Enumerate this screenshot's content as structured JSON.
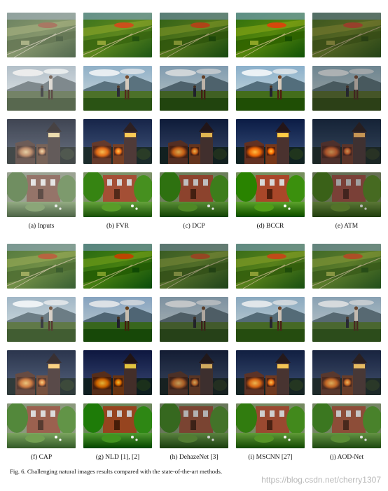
{
  "top_labels": [
    "(a) Inputs",
    "(b) FVR",
    "(c) DCP",
    "(d) BCCR",
    "(e) ATM"
  ],
  "bottom_labels": [
    "(f) CAP",
    "(g) NLD [1], [2]",
    "(h) DehazeNet [3]",
    "(i) MSCNN [27]",
    "(j) AOD-Net"
  ],
  "caption": "Fig. 6.  Challenging natural images results compared with the state-of-the-art methods.",
  "watermark": "https://blog.csdn.net/cherry1307",
  "scenes": [
    "aerial-fields",
    "hiker-mountain",
    "castle-night",
    "garden-house"
  ],
  "top_tones": [
    "inputs",
    "fvr",
    "dcp",
    "bccr",
    "atm"
  ],
  "bottom_tones": [
    "cap",
    "nld",
    "dehaze",
    "mscnn",
    "aod"
  ]
}
